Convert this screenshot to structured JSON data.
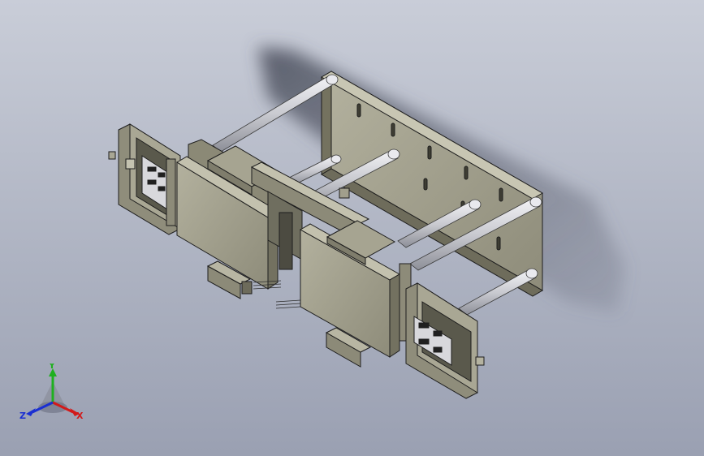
{
  "viewport": {
    "background_top": "#c9cdd8",
    "background_bottom": "#9aa0b2"
  },
  "model": {
    "part_color": "#9c9a87",
    "part_dark": "#6f6d5e",
    "part_light": "#c2c0ad",
    "rod_color": "#d9dadf",
    "edge_color": "#1e1e1e"
  },
  "triad": {
    "x_label": "X",
    "y_label": "Y",
    "z_label": "Z",
    "x_color": "#d21a1a",
    "y_color": "#1fb01f",
    "z_color": "#1a2fd2"
  }
}
